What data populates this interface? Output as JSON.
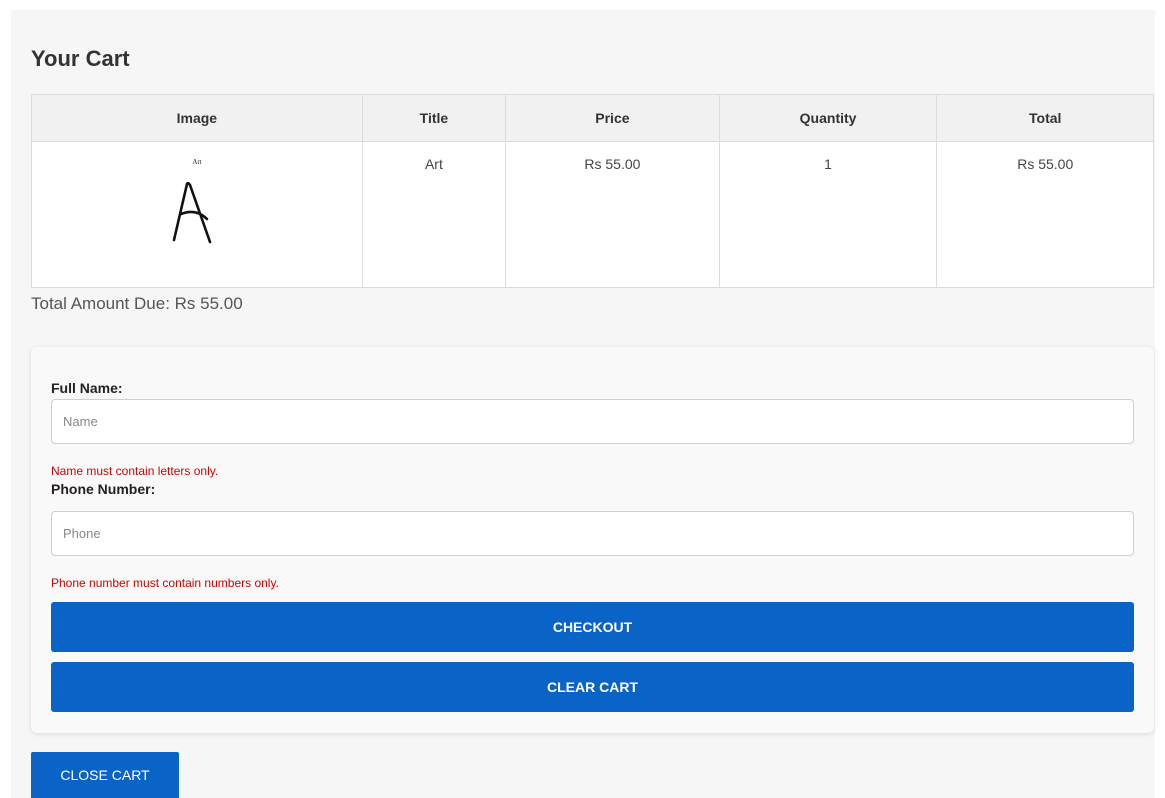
{
  "cart": {
    "title": "Your Cart",
    "columns": [
      "Image",
      "Title",
      "Price",
      "Quantity",
      "Total"
    ],
    "items": [
      {
        "image_caption": "Art",
        "image_glyph": "A",
        "title": "Art",
        "price": "Rs 55.00",
        "quantity": "1",
        "total": "Rs 55.00"
      }
    ],
    "total_due": "Total Amount Due: Rs 55.00"
  },
  "form": {
    "name_label": "Full Name:",
    "name_placeholder": "Name",
    "name_error": "Name must contain letters only.",
    "phone_label": "Phone Number:",
    "phone_placeholder": "Phone",
    "phone_error": "Phone number must contain numbers only.",
    "checkout_label": "CHECKOUT",
    "clear_label": "CLEAR CART"
  },
  "close_label": "CLOSE CART",
  "colors": {
    "accent": "#0a64c8",
    "error": "#d40000"
  }
}
